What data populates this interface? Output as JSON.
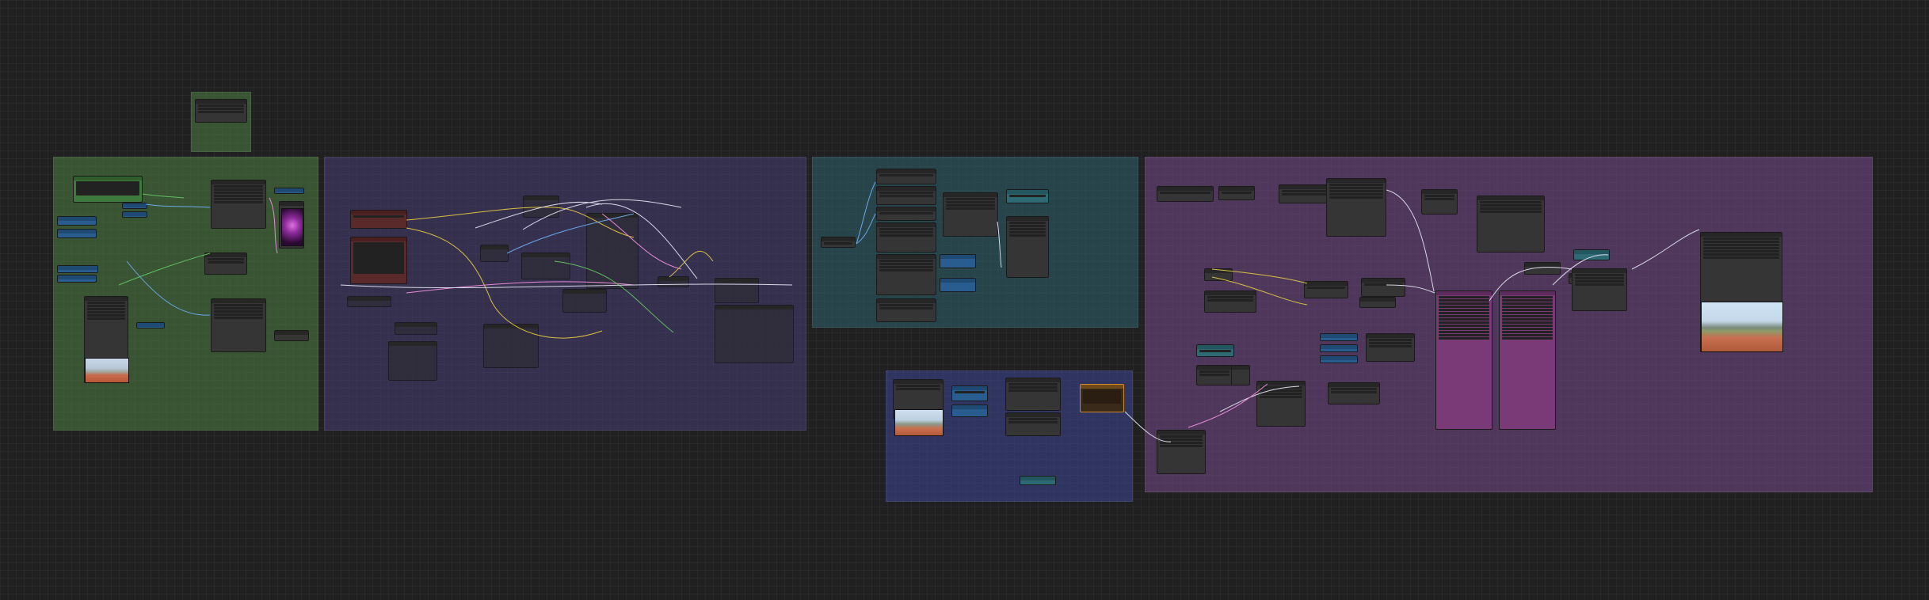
{
  "app": {
    "title": ""
  },
  "groups": {
    "load_models": {
      "title": ""
    },
    "prompt_setup": {
      "title": ""
    },
    "controlnet": {
      "title": ""
    },
    "face_detailer": {
      "title": ""
    },
    "video_frames": {
      "title": ""
    },
    "top_floating": {
      "title": ""
    }
  },
  "colors": {
    "canvas": "#202020",
    "group_green": "#4c8044",
    "group_purple": "#483e76",
    "group_teal": "#306270",
    "group_blue": "#3a428c",
    "group_violet": "#6e4882",
    "wire_yellow": "#d8c040",
    "wire_blue": "#6aa8e8",
    "wire_white": "#d8d8e8",
    "wire_pink": "#e88ad8",
    "wire_green": "#60c060"
  },
  "icons": {
    "preview_dancer": "image-thumbnail-icon",
    "preview_runner": "image-thumbnail-icon",
    "preview_track": "image-thumbnail-icon"
  }
}
